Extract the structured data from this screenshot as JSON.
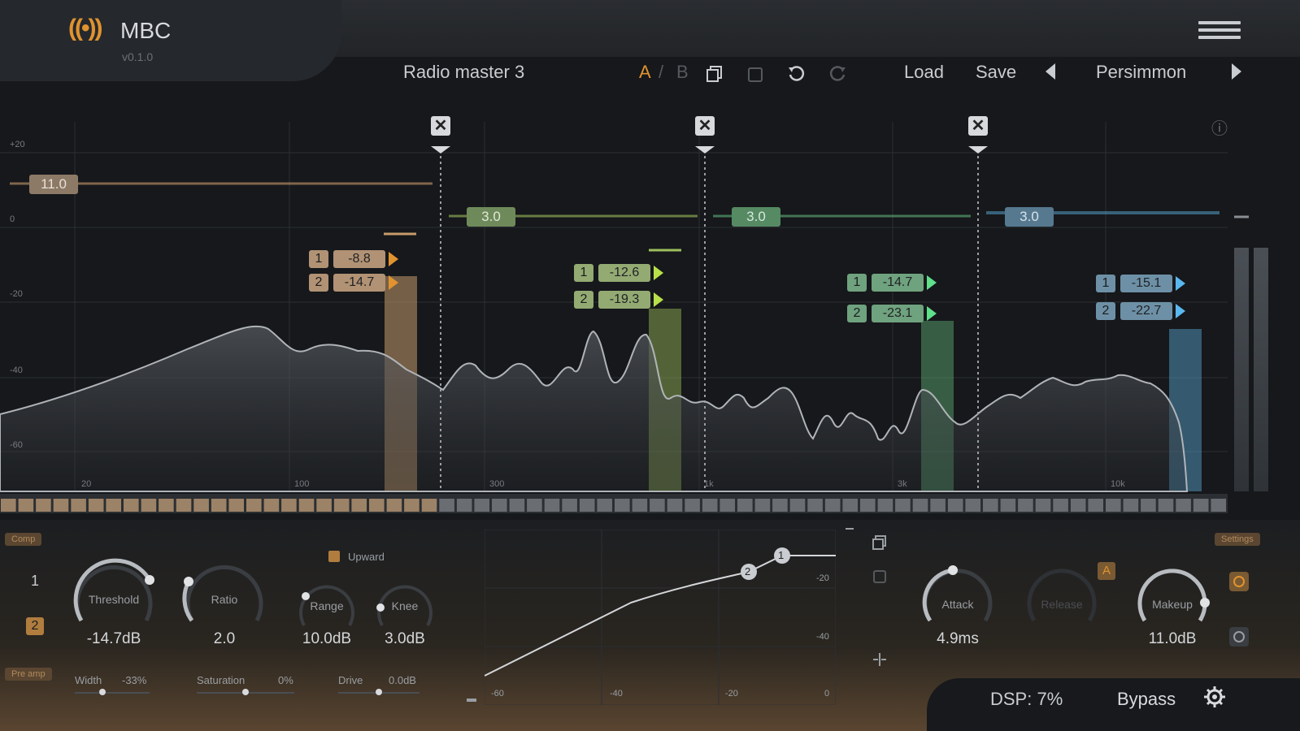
{
  "app": {
    "logo_glyph": "((•))",
    "name": "MBC",
    "version": "v0.1.0"
  },
  "toolbar": {
    "preset_name": "Radio master 3",
    "ab_a": "A",
    "ab_sep": "/",
    "ab_b": "B",
    "load_label": "Load",
    "save_label": "Save",
    "theme_name": "Persimmon"
  },
  "spectrum": {
    "db_labels": [
      "+20",
      "0",
      "-20",
      "-40",
      "-60"
    ],
    "freq_labels": [
      "20",
      "100",
      "300",
      "1k",
      "3k",
      "10k"
    ],
    "close_glyph": "✕",
    "bands": [
      {
        "gain": "11.0",
        "row1_num": "1",
        "row1_val": "-8.8",
        "row2_num": "2",
        "row2_val": "-14.7",
        "color": "#c79b6b"
      },
      {
        "gain": "3.0",
        "row1_num": "1",
        "row1_val": "-12.6",
        "row2_num": "2",
        "row2_val": "-19.3",
        "color": "#9dbf5c"
      },
      {
        "gain": "3.0",
        "row1_num": "1",
        "row1_val": "-14.7",
        "row2_num": "2",
        "row2_val": "-23.1",
        "color": "#5fb37a"
      },
      {
        "gain": "3.0",
        "row1_num": "1",
        "row1_val": "-15.1",
        "row2_num": "2",
        "row2_val": "-22.7",
        "color": "#5aa9d6"
      }
    ],
    "info_glyph": "ⓘ"
  },
  "compressor": {
    "tag_comp": "Comp",
    "tag_pre_amp": "Pre amp",
    "tag_settings": "Settings",
    "thr_num_1": "1",
    "thr_num_2": "2",
    "upward_label": "Upward",
    "knobs": {
      "threshold": {
        "label": "Threshold",
        "value": "-14.7dB"
      },
      "ratio": {
        "label": "Ratio",
        "value": "2.0"
      },
      "range": {
        "label": "Range",
        "value": "10.0dB"
      },
      "knee": {
        "label": "Knee",
        "value": "3.0dB"
      },
      "attack": {
        "label": "Attack",
        "value": "4.9ms"
      },
      "release": {
        "label": "Release",
        "value": ""
      },
      "makeup": {
        "label": "Makeup",
        "value": "11.0dB"
      }
    },
    "auto_badge": "A",
    "preamp": {
      "width_label": "Width",
      "width_value": "-33%",
      "saturation_label": "Saturation",
      "saturation_value": "0%",
      "drive_label": "Drive",
      "drive_value": "0.0dB"
    },
    "curve": {
      "x_labels": [
        "-60",
        "-40",
        "-20",
        "0"
      ],
      "y_labels": [
        "-20",
        "-40"
      ],
      "node1": "1",
      "node2": "2"
    }
  },
  "status": {
    "dsp": "DSP: 7%",
    "bypass": "Bypass"
  },
  "colors": {
    "accent": "#e0932f",
    "band_low": "#c79b6b",
    "band_mid": "#9dbf5c",
    "band_hmid": "#5fb37a",
    "band_high": "#5aa9d6"
  }
}
